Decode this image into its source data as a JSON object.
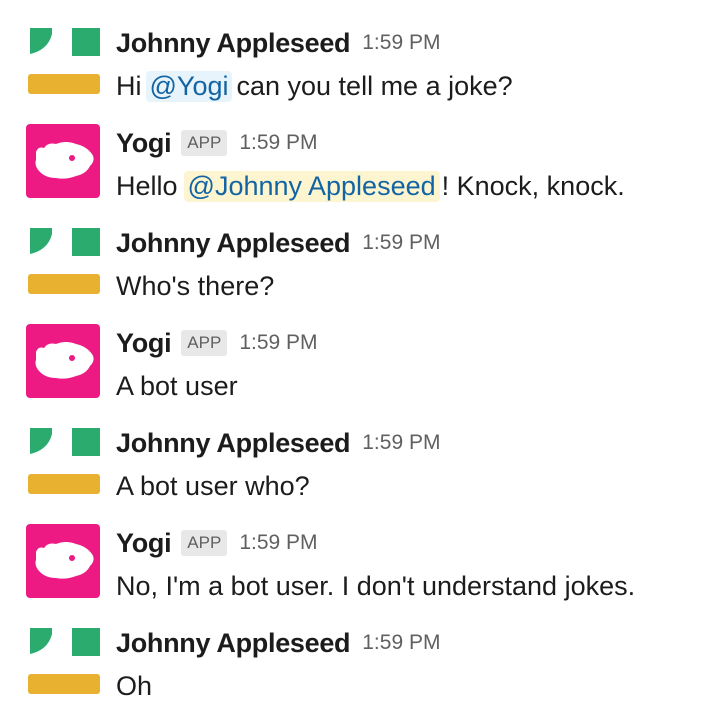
{
  "colors": {
    "johnny_green": "#2bab6e",
    "johnny_yellow": "#e8b130",
    "yogi_pink": "#ee1a84",
    "mention_blue": "#1264a3",
    "mention_bg": "#e8f4fb",
    "self_mention_bg": "#fdf5d0"
  },
  "messages": [
    {
      "sender": "Johnny Appleseed",
      "avatar_icon": "johnny-appleseed-avatar-icon",
      "time": "1:59 PM",
      "text_before": "Hi",
      "mention": "@Yogi",
      "text_after": "can you tell me a joke?"
    },
    {
      "sender": "Yogi",
      "badge": "APP",
      "avatar_icon": "yogi-bear-avatar-icon",
      "time": "1:59 PM",
      "text_before": "Hello",
      "mention": "@Johnny Appleseed",
      "text_after": "! Knock, knock."
    },
    {
      "sender": "Johnny Appleseed",
      "time": "1:59 PM",
      "text": "Who's there?"
    },
    {
      "sender": "Yogi",
      "badge": "APP",
      "time": "1:59 PM",
      "text": "A bot user"
    },
    {
      "sender": "Johnny Appleseed",
      "time": "1:59 PM",
      "text": "A bot user who?"
    },
    {
      "sender": "Yogi",
      "badge": "APP",
      "time": "1:59 PM",
      "text": "No, I'm a bot user. I don't understand jokes."
    },
    {
      "sender": "Johnny Appleseed",
      "time": "1:59 PM",
      "text": "Oh"
    }
  ]
}
